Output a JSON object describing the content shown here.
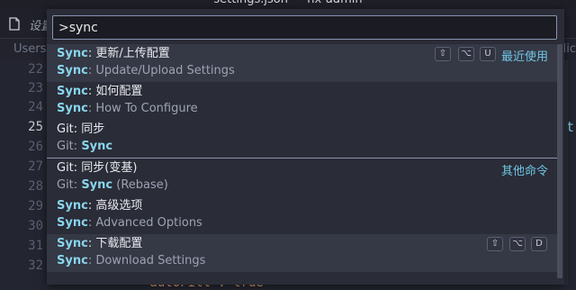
{
  "window": {
    "title": "settings.json — nx-admin"
  },
  "tab": {
    "label": "设置"
  },
  "breadcrumb": {
    "left": "Users",
    "right": "olic"
  },
  "gutter": {
    "line_numbers": [
      "22",
      "23",
      "24",
      "25",
      "26",
      "27",
      "28",
      "29",
      "30",
      "31",
      "32"
    ],
    "current_line": "25"
  },
  "editor": {
    "peek_right": "t",
    "bottom_snippet": "\"autoFill\": true"
  },
  "palette": {
    "input_value": ">sync",
    "items": [
      {
        "prefix": "Sync",
        "title": ": 更新/上传配置",
        "detail_prefix": "Sync",
        "detail": ": Update/Upload Settings",
        "keys": [
          "⇧",
          "⌥",
          "U"
        ],
        "right_label": "最近使用"
      },
      {
        "prefix": "Sync",
        "title": ": 如何配置",
        "detail_prefix": "Sync",
        "detail": ": How To Configure"
      },
      {
        "prefix": "Git",
        "title": ": 同步",
        "detail_prefix": "Git:",
        "detail_kw": "Sync",
        "detail": ""
      },
      {
        "prefix": "Git",
        "title": ": 同步(变基)",
        "detail_prefix": "Git:",
        "detail_kw": "Sync",
        "detail": " (Rebase)",
        "right_label": "其他命令"
      },
      {
        "prefix": "Sync",
        "title": ": 高级选项",
        "detail_prefix": "Sync",
        "detail": ": Advanced Options"
      },
      {
        "prefix": "Sync",
        "title": ": 下载配置",
        "detail_prefix": "Sync",
        "detail": ": Download Settings",
        "keys": [
          "⇧",
          "⌥",
          "D"
        ]
      }
    ]
  },
  "colors": {
    "accent": "#88d5ec",
    "palette_bg": "#2a2c37",
    "highlight": "#353845",
    "divider": "#8d90b0"
  }
}
